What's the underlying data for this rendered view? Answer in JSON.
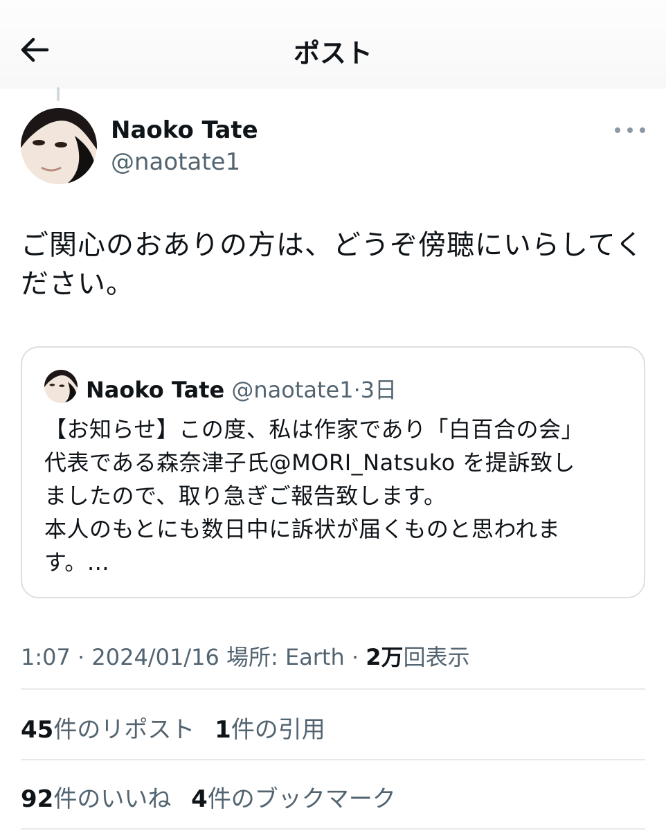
{
  "header": {
    "title": "ポスト",
    "back_icon": "arrow-left-icon"
  },
  "post": {
    "author_name": "Naoko Tate",
    "author_handle": "@naotate1",
    "text": "ご関心のおありの方は、どうぞ傍聴にいらしてください。"
  },
  "quote": {
    "author_name": "Naoko Tate",
    "author_handle": "@naotate1",
    "separator": "·",
    "age": "3日",
    "lines": [
      "【お知らせ】この度、私は作家であり「白百合の会」",
      "代表である森奈津子氏@MORI_Natsuko を提訴致し",
      "ましたので、取り急ぎご報告致します。",
      "本人のもとにも数日中に訴状が届くものと思われま",
      "す。…"
    ]
  },
  "meta": {
    "time": "1:07",
    "sep1": "·",
    "date": "2024/01/16",
    "location_label": "場所: Earth",
    "sep2": "·",
    "views_count": "2万",
    "views_label": "回表示"
  },
  "stats": {
    "reposts_count": "45",
    "reposts_label": "件のリポスト",
    "quotes_count": "1",
    "quotes_label": "件の引用",
    "likes_count": "92",
    "likes_label": "件のいいね",
    "bookmarks_count": "4",
    "bookmarks_label": "件のブックマーク"
  },
  "colors": {
    "text": "#0f1419",
    "secondary": "#536471",
    "border": "#dcdfe3"
  }
}
